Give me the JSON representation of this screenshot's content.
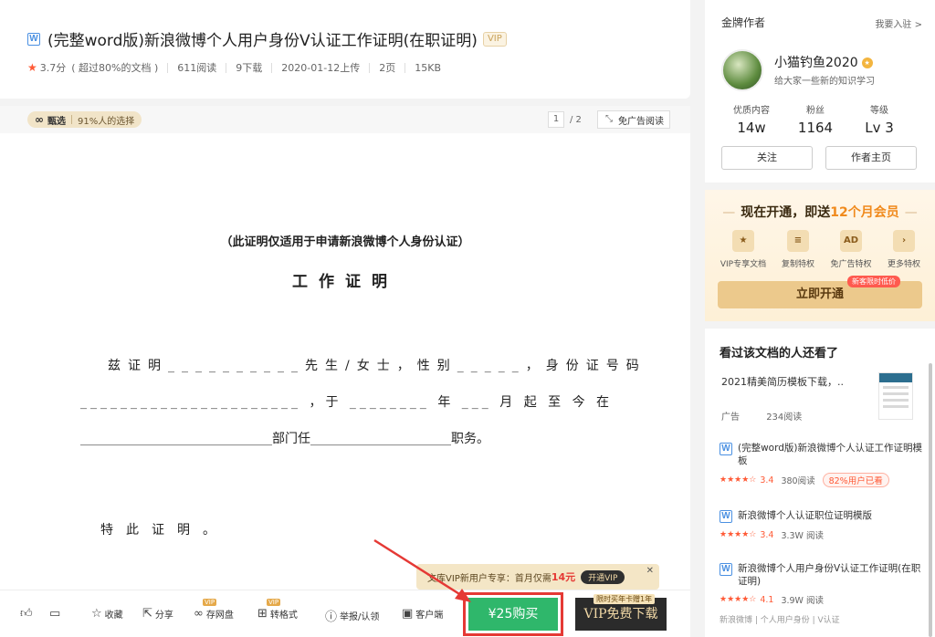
{
  "header": {
    "file_icon": "W",
    "title": "(完整word版)新浪微博个人用户身份V认证工作证明(在职证明)",
    "vip_tag": "VIP",
    "rating": "3.7分",
    "rating_note": "( 超过80%的文档 )",
    "reads": "611阅读",
    "downloads": "9下载",
    "upload_date": "2020-01-12上传",
    "pages": "2页",
    "size": "15KB"
  },
  "doc_toolbar": {
    "select_label": "甄选",
    "select_note": "91%人的选择",
    "page_current": "1",
    "page_total": "/ 2",
    "adfree_label": "免广告阅读"
  },
  "document": {
    "notice": "（此证明仅适用于申请新浪微博个人身份认证）",
    "heading": "工作证明",
    "line1": "兹证明__________先生/女士，性别_____，身份证号码",
    "line2": "______________________ ，于 ________ 年 ___ 月 起 至 今 在",
    "line3": "______________________________部门任______________________职务。",
    "line4": "特此证明。"
  },
  "vip_promo": {
    "text": "文库VIP新用户专享：首月仅需",
    "price": "14元",
    "button": "开通VIP",
    "close": "✕"
  },
  "bottom_bar": {
    "like": "",
    "comment": "",
    "favorite": "收藏",
    "share": "分享",
    "save_disk": "存网盘",
    "convert": "转格式",
    "report": "举报/认领",
    "client": "客户端",
    "vip_mini": "VIP",
    "buy": "¥25购买",
    "vip_download": "VIP免费下载",
    "vip_download_tag": "限时买年卡赠1年"
  },
  "author": {
    "heading": "金牌作者",
    "join": "我要入驻 >",
    "name": "小猫钓鱼2020",
    "slogan": "给大家一些新的知识学习",
    "stats": [
      {
        "label": "优质内容",
        "value": "14w"
      },
      {
        "label": "粉丝",
        "value": "1164"
      },
      {
        "label": "等级",
        "value": "Lv 3"
      }
    ],
    "follow": "关注",
    "homepage": "作者主页"
  },
  "vip_card": {
    "title_prefix": "现在开通，即送",
    "title_highlight": "12个月会员",
    "perks": [
      {
        "icon": "★",
        "label": "VIP专享文档"
      },
      {
        "icon": "≡",
        "label": "复制特权"
      },
      {
        "icon": "AD",
        "label": "免广告特权"
      },
      {
        "icon": "›",
        "label": "更多特权"
      }
    ],
    "open_button": "立即开通",
    "new_tag": "新客限时低价"
  },
  "recommend": {
    "heading": "看过该文档的人还看了",
    "ad": {
      "title": "2021精美简历模板下载，..",
      "tag": "广告",
      "reads": "234阅读"
    },
    "items": [
      {
        "title": "(完整word版)新浪微博个人认证工作证明模板",
        "stars": "★★★★☆",
        "score": "3.4",
        "reads": "380阅读",
        "pct": "82%用户已看"
      },
      {
        "title": "新浪微博个人认证职位证明模版",
        "stars": "★★★★☆",
        "score": "3.4",
        "reads": "3.3W 阅读",
        "pct": ""
      },
      {
        "title": "新浪微博个人用户身份V认证工作证明(在职证明)",
        "stars": "★★★★☆",
        "score": "4.1",
        "reads": "3.9W 阅读",
        "pct": ""
      }
    ],
    "tail": "新浪微博 | 个人用户身份 | V认证"
  }
}
